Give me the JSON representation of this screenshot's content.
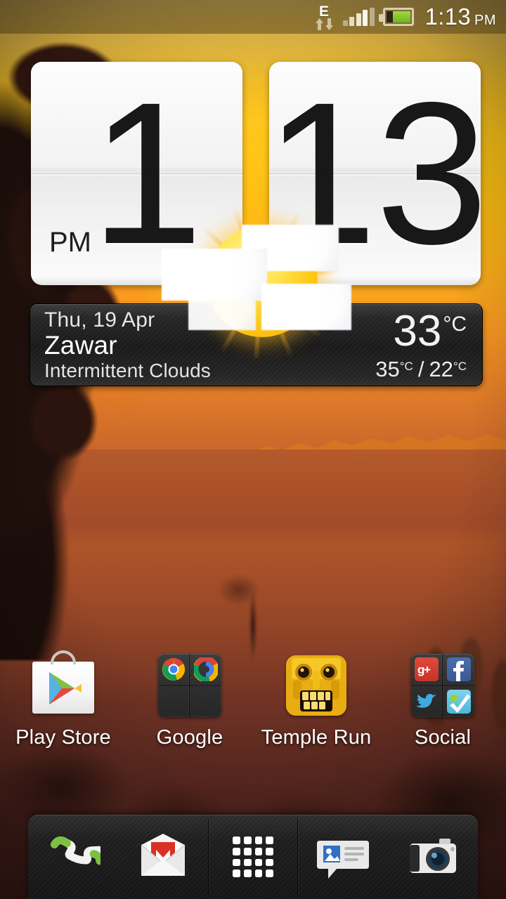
{
  "status_bar": {
    "network_type": "E",
    "data_arrows_icon": "data-transfer-arrows-icon",
    "signal_icon": "signal-bars-icon",
    "signal_bars_total": 5,
    "signal_bars_active": 4,
    "battery_icon": "battery-icon",
    "battery_level_percent": 75,
    "battery_color": "#8dcc2e",
    "time": "1:13",
    "time_period": "PM",
    "background_color": "#ab9a6e"
  },
  "clock_widget": {
    "name": "flip-clock",
    "hour": "1",
    "minute": "13",
    "period": "PM"
  },
  "weather": {
    "icon_name": "sun-behind-clouds-icon",
    "date": "Thu, 19 Apr",
    "city": "Zawar",
    "condition": "Intermittent Clouds",
    "current_temp": "33",
    "unit": "°C",
    "high_temp": "35",
    "low_temp": "22",
    "range_separator": "/",
    "panel_color": "#1a1a1a"
  },
  "apps": [
    {
      "label": "Play Store",
      "icon_name": "play-store-icon",
      "type": "app"
    },
    {
      "label": "Google",
      "icon_name": "folder-icon",
      "type": "folder",
      "contents": [
        {
          "name": "chrome-icon"
        },
        {
          "name": "chrome-beta-icon"
        },
        {
          "name": "empty-slot"
        },
        {
          "name": "empty-slot"
        }
      ]
    },
    {
      "label": "Temple Run",
      "icon_name": "temple-run-icon",
      "type": "app"
    },
    {
      "label": "Social",
      "icon_name": "folder-icon",
      "type": "folder",
      "contents": [
        {
          "name": "google-plus-icon"
        },
        {
          "name": "facebook-icon"
        },
        {
          "name": "twitter-icon"
        },
        {
          "name": "foursquare-icon"
        }
      ]
    }
  ],
  "dock": [
    {
      "icon_name": "phone-icon"
    },
    {
      "icon_name": "gmail-icon"
    },
    {
      "icon_name": "all-apps-grid-icon"
    },
    {
      "icon_name": "messages-icon"
    },
    {
      "icon_name": "camera-icon"
    }
  ],
  "wallpaper": {
    "name": "desert-sunset-cactus-wallpaper",
    "sky_color": "#ffc617",
    "ground_color": "#8a3f26"
  }
}
